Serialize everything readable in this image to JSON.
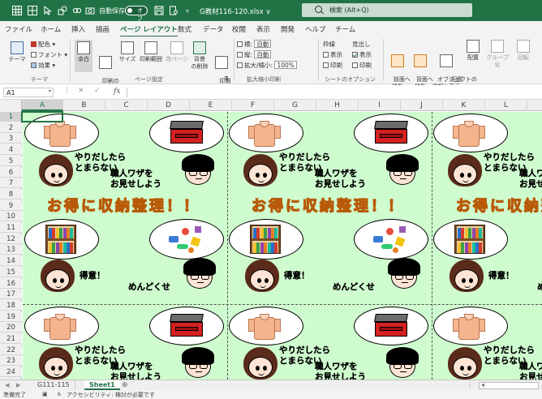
{
  "titlebar": {
    "autosave_label": "自動保存",
    "autosave_state": "オフ",
    "filename": "G教材116-120.xlsx ∨",
    "search_placeholder": "検索 (Alt+Q)"
  },
  "menu": [
    "ファイル",
    "ホーム",
    "挿入",
    "描画",
    "ページ レイアウト",
    "数式",
    "データ",
    "校閲",
    "表示",
    "開発",
    "ヘルプ",
    "チーム"
  ],
  "menu_active_index": 4,
  "ribbon": {
    "themes": {
      "theme": "テーマ",
      "colors": "配色",
      "fonts": "フォント",
      "effects": "効果",
      "group": "テーマ"
    },
    "page_setup": {
      "margins": "余白",
      "orientation": "印刷の\n向き",
      "size": "サイズ",
      "print_area": "印刷範囲",
      "breaks": "改ページ",
      "background": "背景",
      "print_titles": "印刷\nタイトル",
      "delete_bg": "の削除",
      "group": "ページ設定"
    },
    "scale": {
      "width_label": "横:",
      "width_value": "自動",
      "height_label": "縦:",
      "height_value": "自動",
      "scale_label": "拡大/縮小:",
      "scale_value": "100%",
      "group": "拡大縮小印刷"
    },
    "sheet_options": {
      "gridlines": "枠線",
      "headings": "見出し",
      "view": "表示",
      "print": "印刷",
      "gridlines_view": false,
      "gridlines_print": false,
      "headings_view": true,
      "headings_print": false,
      "group": "シートのオプション"
    },
    "arrange": {
      "bring_forward": "前面へ\n移動",
      "send_backward": "背面へ\n移動",
      "selection_pane": "オブジェクトの\n選択と表示",
      "align": "配置",
      "group_btn": "グループ化",
      "rotate": "回転",
      "group": "配置"
    }
  },
  "formula_bar": {
    "namebox": "A1",
    "fx": "fx",
    "value": ""
  },
  "columns": [
    "A",
    "B",
    "C",
    "D",
    "E",
    "F",
    "G",
    "H",
    "I",
    "J",
    "K",
    "L"
  ],
  "rows": [
    "1",
    "2",
    "3",
    "4",
    "5",
    "6",
    "7",
    "8",
    "9",
    "10",
    "11",
    "12",
    "13",
    "14",
    "15",
    "16",
    "17",
    "18",
    "19",
    "20",
    "21",
    "22",
    "23",
    "24"
  ],
  "selected_cell": "A1",
  "worksheet_text": {
    "girl_shirt": "やりだしたら\nとまらない",
    "boy_tools": "職人ワザを\nお見せしよう",
    "headline": "お得に収納整理！！",
    "girl_books": "得意！",
    "boy_toys": "めんどくせ"
  },
  "sheet_tabs": [
    "G111-115",
    "Sheet1"
  ],
  "active_sheet": 1,
  "status": {
    "ready": "準備完了",
    "accessibility": "アクセシビリティ: 検討が必要です"
  }
}
